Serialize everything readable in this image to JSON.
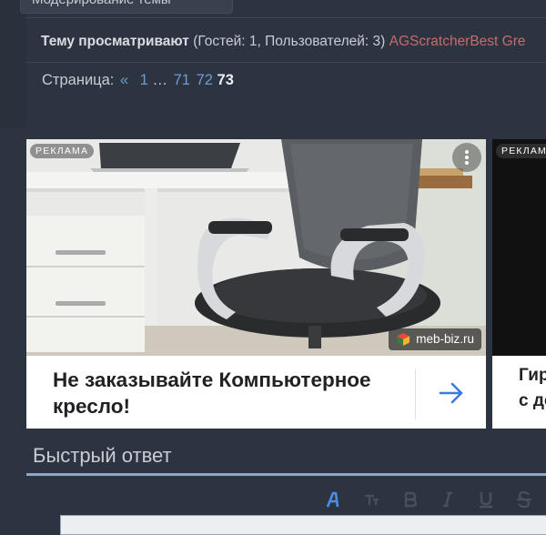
{
  "moderation": {
    "label": "Модерирование темы"
  },
  "viewers": {
    "label": "Тему просматривают",
    "counts": "(Гостей: 1, Пользователей: 3)",
    "users": "AGScratcherBest Gre"
  },
  "pagination": {
    "label": "Страница:",
    "prev": "«",
    "first": "1",
    "ellipsis": "…",
    "pages": [
      "71",
      "72"
    ],
    "current": "73"
  },
  "ad": {
    "badge": "РЕКЛАМА",
    "domain": "meb-biz.ru",
    "title": "Не заказывайте Компьютерное кресло!",
    "more_icon": "more-vertical-icon",
    "arrow_icon": "arrow-right-icon"
  },
  "ad2": {
    "badge": "РЕКЛАМА",
    "title_line1": "Гир",
    "title_line2": "с до"
  },
  "quick_reply": {
    "title": "Быстрый ответ"
  },
  "toolbar": {
    "icons": [
      "font-icon",
      "font-size-icon",
      "bold-icon",
      "italic-icon",
      "underline-icon",
      "strikethrough-icon"
    ]
  }
}
